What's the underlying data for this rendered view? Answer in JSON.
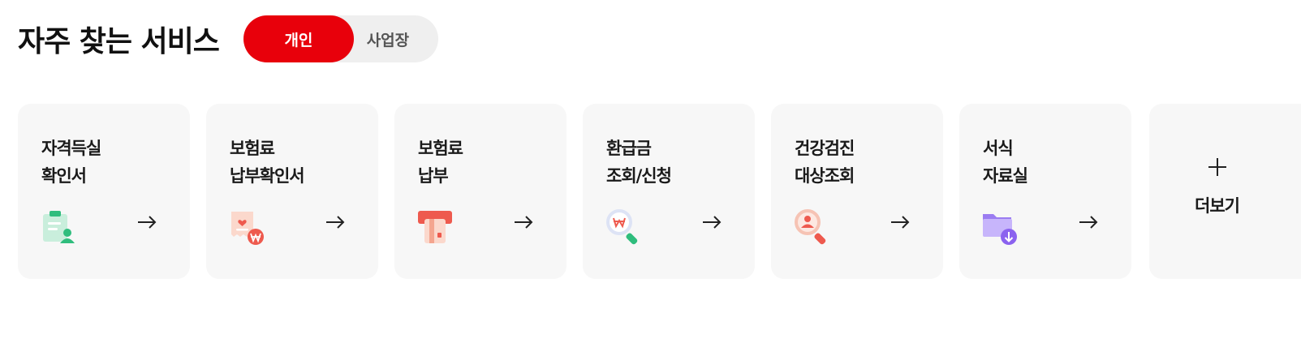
{
  "header": {
    "title": "자주 찾는 서비스",
    "tabs": [
      {
        "label": "개인",
        "active": true
      },
      {
        "label": "사업장",
        "active": false
      }
    ]
  },
  "services": [
    {
      "line1": "자격득실",
      "line2": "확인서",
      "icon": "clipboard-person-icon"
    },
    {
      "line1": "보험료",
      "line2": "납부확인서",
      "icon": "receipt-won-icon"
    },
    {
      "line1": "보험료",
      "line2": "납부",
      "icon": "card-payment-icon"
    },
    {
      "line1": "환급금",
      "line2": "조회/신청",
      "icon": "search-won-icon"
    },
    {
      "line1": "건강검진",
      "line2": "대상조회",
      "icon": "search-person-icon"
    },
    {
      "line1": "서식",
      "line2": "자료실",
      "icon": "folder-download-icon"
    }
  ],
  "more": {
    "label": "더보기"
  },
  "colors": {
    "accent": "#e8000b",
    "card_bg": "#f7f7f7",
    "toggle_bg": "#efefef"
  }
}
